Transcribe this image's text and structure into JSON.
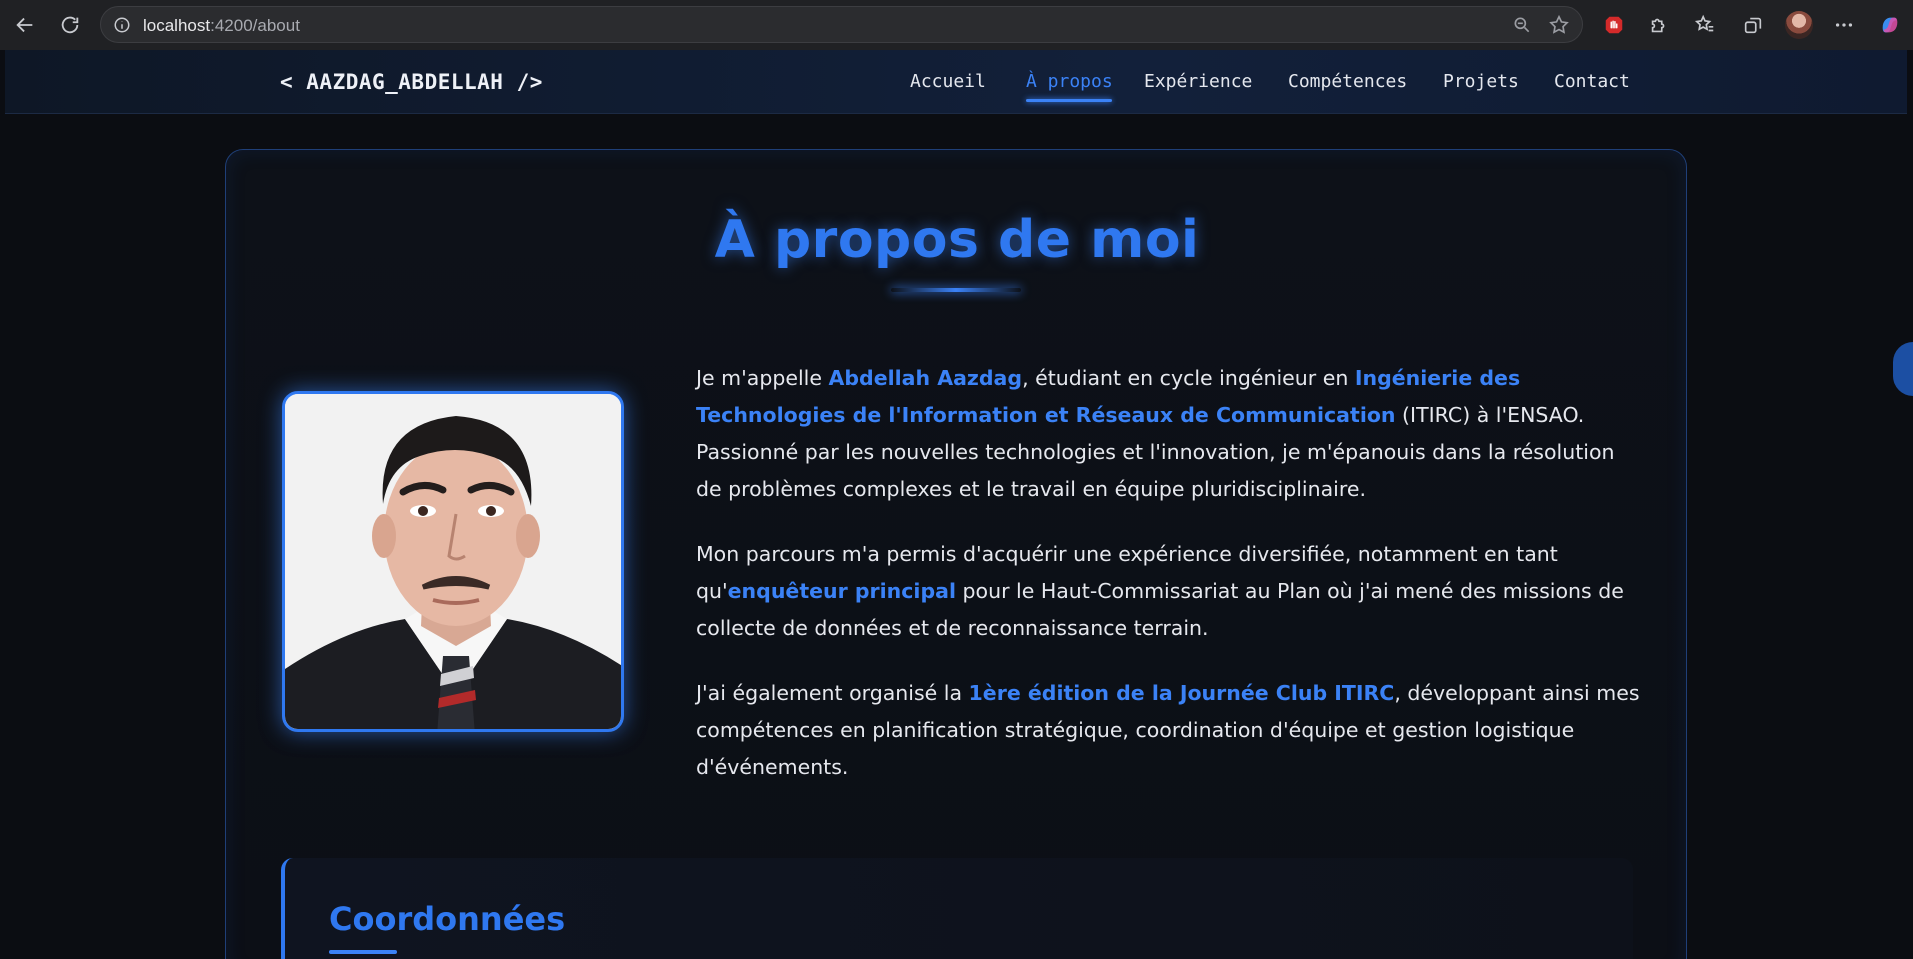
{
  "browser": {
    "url_host": "localhost",
    "url_rest": ":4200/about"
  },
  "header": {
    "logo": "< AAZDAG_ABDELLAH />",
    "nav": [
      {
        "label": "Accueil"
      },
      {
        "label": "À propos"
      },
      {
        "label": "Expérience"
      },
      {
        "label": "Compétences"
      },
      {
        "label": "Projets"
      },
      {
        "label": "Contact"
      }
    ]
  },
  "about": {
    "title": "À propos de moi",
    "p1": {
      "t1": "Je m'appelle ",
      "h1": "Abdellah Aazdag",
      "t2": ", étudiant en cycle ingénieur en ",
      "h2": "Ingénierie des Technologies de l'Information et Réseaux de Communication",
      "t3": " (ITIRC) à l'ENSAO. Passionné par les nouvelles technologies et l'innovation, je m'épanouis dans la résolution de problèmes complexes et le travail en équipe pluridisciplinaire."
    },
    "p2": {
      "t1": "Mon parcours m'a permis d'acquérir une expérience diversifiée, notamment en tant qu'",
      "h1": "enquêteur principal",
      "t2": " pour le Haut-Commissariat au Plan où j'ai mené des missions de collecte de données et de reconnaissance terrain."
    },
    "p3": {
      "t1": "J'ai également organisé la ",
      "h1": "1ère édition de la Journée Club ITIRC",
      "t2": ", développant ainsi mes compétences en planification stratégique, coordination d'équipe et gestion logistique d'événements."
    }
  },
  "contact": {
    "title": "Coordonnées"
  },
  "colors": {
    "accent": "#3b82f6",
    "background": "#0b0d12"
  }
}
